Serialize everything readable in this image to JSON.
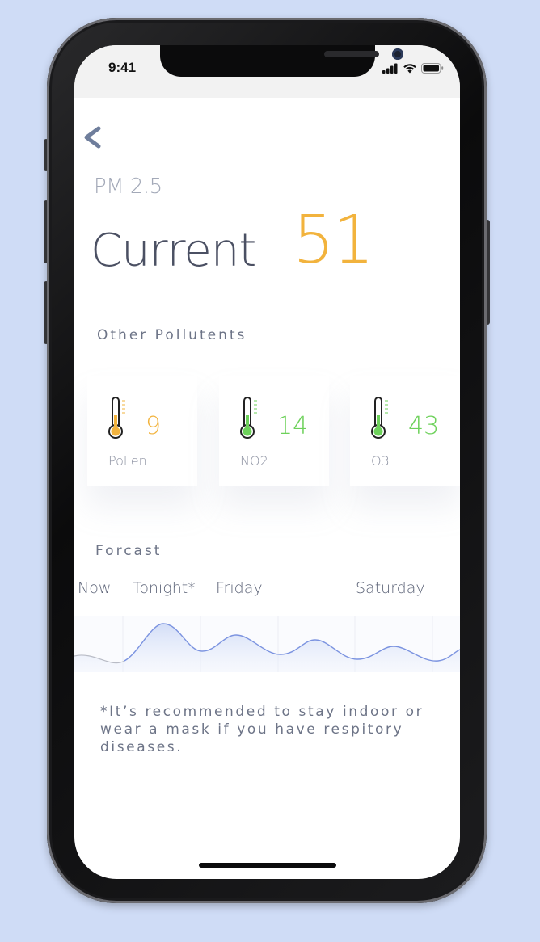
{
  "status_bar": {
    "time": "9:41"
  },
  "header": {
    "metric": "PM 2.5",
    "current_label": "Current",
    "current_value": "51"
  },
  "pollutants": {
    "title": "Other Pollutents",
    "items": [
      {
        "name": "Pollen",
        "value": "9",
        "color": "#f2b33d"
      },
      {
        "name": "NO2",
        "value": "14",
        "color": "#6dd15a"
      },
      {
        "name": "O3",
        "value": "43",
        "color": "#6dd15a"
      }
    ]
  },
  "forecast": {
    "title": "Forcast",
    "labels": [
      "Now",
      "Tonight*",
      "Friday",
      "Saturday"
    ]
  },
  "note": "*It’s recommended to stay indoor or wear a mask if you have respitory diseases.",
  "colors": {
    "accent_yellow": "#f2b33d",
    "accent_green": "#6dd15a",
    "forecast_line": "#7b93e0",
    "background": "#cfdcf6"
  }
}
